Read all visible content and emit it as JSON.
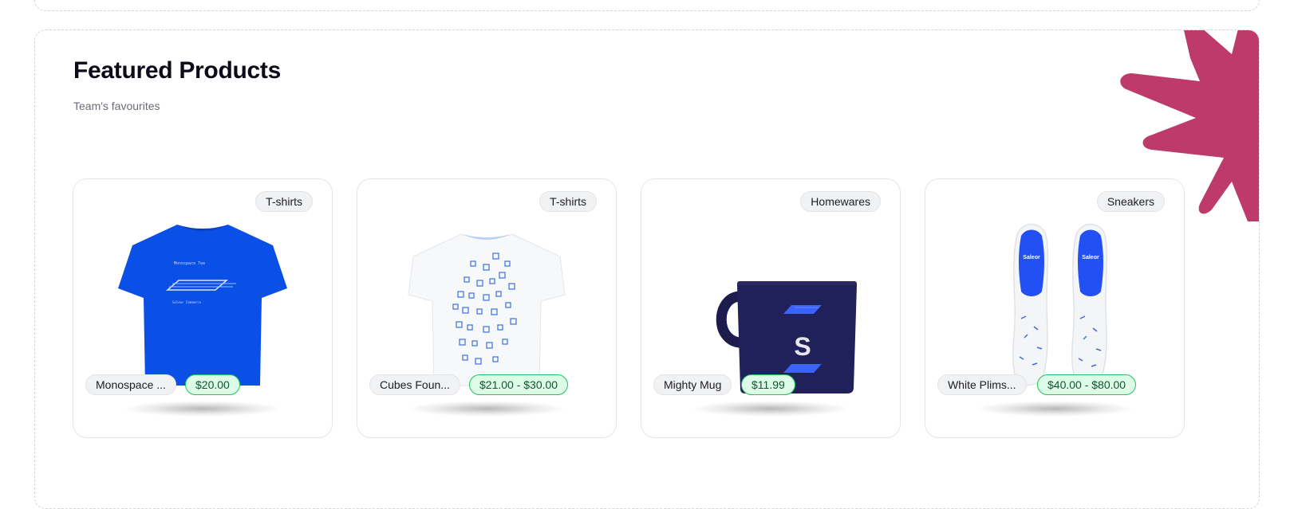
{
  "section": {
    "title": "Featured Products",
    "subtitle": "Team's favourites"
  },
  "colors": {
    "accent_splash": "#bd3a6a",
    "price_bg": "#dcfce7",
    "price_border": "#22c55e",
    "pill_bg": "#f1f2f4"
  },
  "products": [
    {
      "category": "T-shirts",
      "name": "Monospace ...",
      "price": "$20.00",
      "image_icon": "blue-tshirt-image"
    },
    {
      "category": "T-shirts",
      "name": "Cubes Foun...",
      "price": "$21.00 - $30.00",
      "image_icon": "white-cubes-tshirt-image"
    },
    {
      "category": "Homewares",
      "name": "Mighty Mug",
      "price": "$11.99",
      "image_icon": "navy-mug-image"
    },
    {
      "category": "Sneakers",
      "name": "White Plims...",
      "price": "$40.00 - $80.00",
      "image_icon": "white-sneakers-image"
    }
  ]
}
